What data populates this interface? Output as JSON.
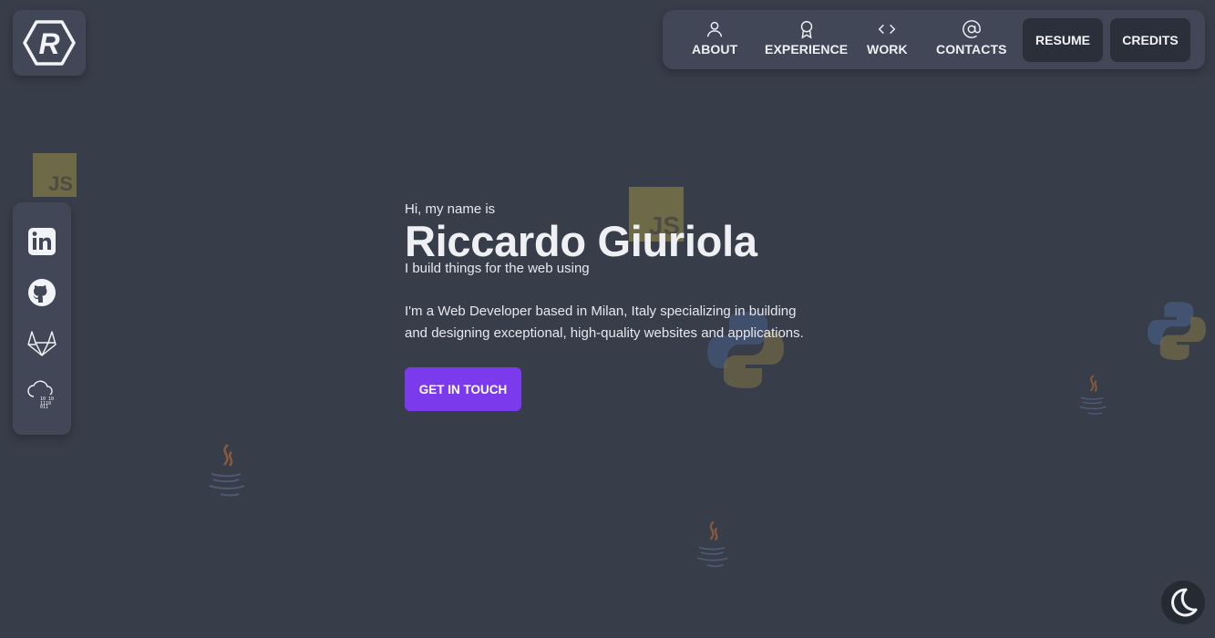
{
  "logo": {
    "letter": "R"
  },
  "nav": {
    "items": [
      {
        "label": "ABOUT",
        "icon": "person-icon"
      },
      {
        "label": "EXPERIENCE",
        "icon": "award-icon"
      },
      {
        "label": "WORK",
        "icon": "code-icon"
      },
      {
        "label": "CONTACTS",
        "icon": "at-icon"
      }
    ],
    "resume_label": "RESUME",
    "credits_label": "CREDITS"
  },
  "social": [
    "linkedin-icon",
    "github-icon",
    "gitlab-icon",
    "cloud-data-icon"
  ],
  "hero": {
    "greeting": "Hi, my name is",
    "name": "Riccardo Giuriola",
    "tagline": "I build things for the web using",
    "bio": "I'm a Web Developer based in Milan, Italy specializing in building and designing exceptional, high-quality websites and applications.",
    "cta_label": "GET IN TOUCH"
  },
  "decorations": {
    "js_label": "JS"
  },
  "colors": {
    "background": "#383d4a",
    "panel": "#414756",
    "accent": "#7c3aed",
    "dark_button": "#2b2f3a"
  },
  "theme_toggle": {
    "icon": "moon-icon"
  }
}
